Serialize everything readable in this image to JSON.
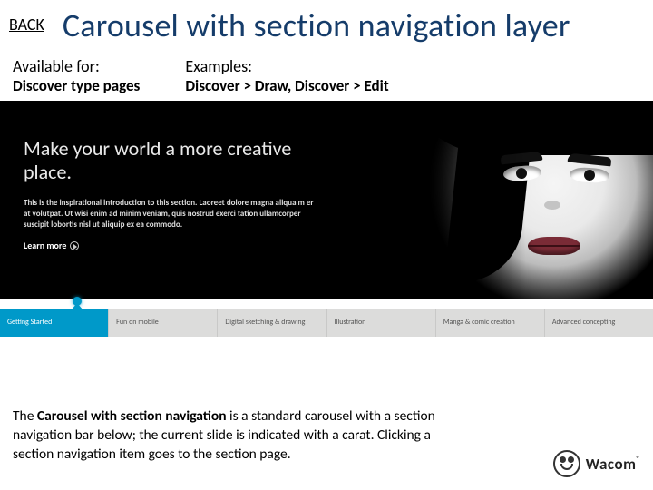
{
  "header": {
    "back": "BACK",
    "title": "Carousel with section navigation layer"
  },
  "meta": {
    "available_label": "Available for:",
    "available_value": "Discover type pages",
    "examples_label": "Examples:",
    "examples_value": "Discover > Draw, Discover > Edit"
  },
  "hero": {
    "headline": "Make your world a more creative place.",
    "body": "This is the inspirational introduction to this section. Laoreet dolore magna aliqua m er at volutpat. Ut wisi enim ad minim veniam, quis nostrud exerci tation ullamcorper suscipit lobortis nisl ut aliquip ex ea commodo.",
    "learn": "Learn more"
  },
  "nav": {
    "active_index": 0,
    "items": [
      {
        "label": "Getting Started"
      },
      {
        "label": "Fun on mobile"
      },
      {
        "label": "Digital sketching & drawing"
      },
      {
        "label": "Illustration"
      },
      {
        "label": "Manga & comic creation"
      },
      {
        "label": "Advanced concepting"
      }
    ]
  },
  "description": {
    "lead": "The ",
    "bold": "Carousel with section navigation",
    "rest": " is a standard carousel with a section navigation bar below; the current slide is indicated with a carat. Clicking a section navigation item goes to the section page."
  },
  "logo": {
    "text": "Wacom",
    "reg": "®"
  }
}
